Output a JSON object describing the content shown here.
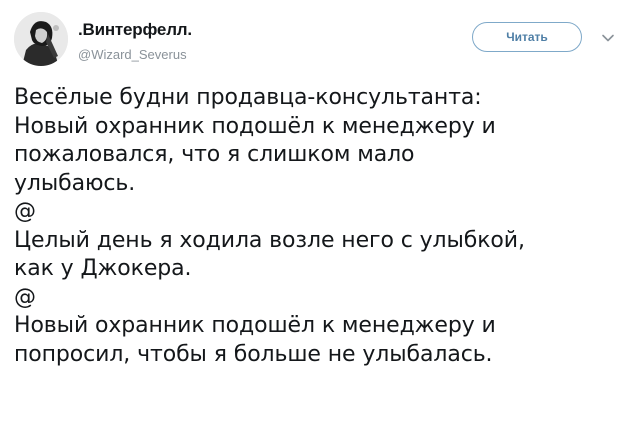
{
  "author": {
    "display_name": ".Винтерфелл.",
    "handle": "@Wizard_Severus"
  },
  "follow_button": {
    "label": "Читать"
  },
  "icons": {
    "more": "chevron-down-icon",
    "avatar": "avatar-image"
  },
  "colors": {
    "follow_border": "#7fa9c9",
    "follow_text": "#4f7fa6",
    "handle_text": "#8a9299",
    "body_text": "#14171a"
  },
  "tweet": {
    "lines": [
      "Весёлые будни продавца-консультанта:",
      "Новый охранник подошёл к менеджеру и",
      "пожаловался, что я слишком мало",
      "улыбаюсь.",
      "@",
      "Целый день я ходила возле него с улыбкой,",
      "как у Джокера.",
      "@",
      "Новый охранник подошёл к менеджеру и",
      "попросил, чтобы я больше не улыбалась."
    ]
  }
}
